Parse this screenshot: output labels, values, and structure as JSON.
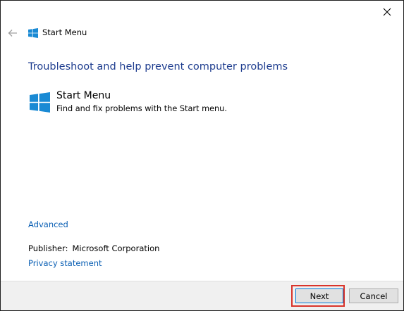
{
  "window": {
    "title": "Start Menu",
    "close_glyph": "✕"
  },
  "header": {
    "back_icon": "arrow-left-icon",
    "logo_icon": "windows-logo-icon",
    "title": "Start Menu"
  },
  "main": {
    "heading": "Troubleshoot and help prevent computer problems",
    "item": {
      "icon": "windows-logo-icon",
      "title": "Start Menu",
      "description": "Find and fix problems with the Start menu."
    },
    "advanced_link": "Advanced",
    "publisher_label": "Publisher:",
    "publisher_value": "Microsoft Corporation",
    "privacy_link": "Privacy statement"
  },
  "footer": {
    "next_label": "Next",
    "cancel_label": "Cancel"
  },
  "colors": {
    "heading": "#1e3d8f",
    "link": "#0a5fb4",
    "windows_logo": "#1a8ad4",
    "highlight": "#d9342b",
    "footer_bg": "#f0f0f0"
  }
}
